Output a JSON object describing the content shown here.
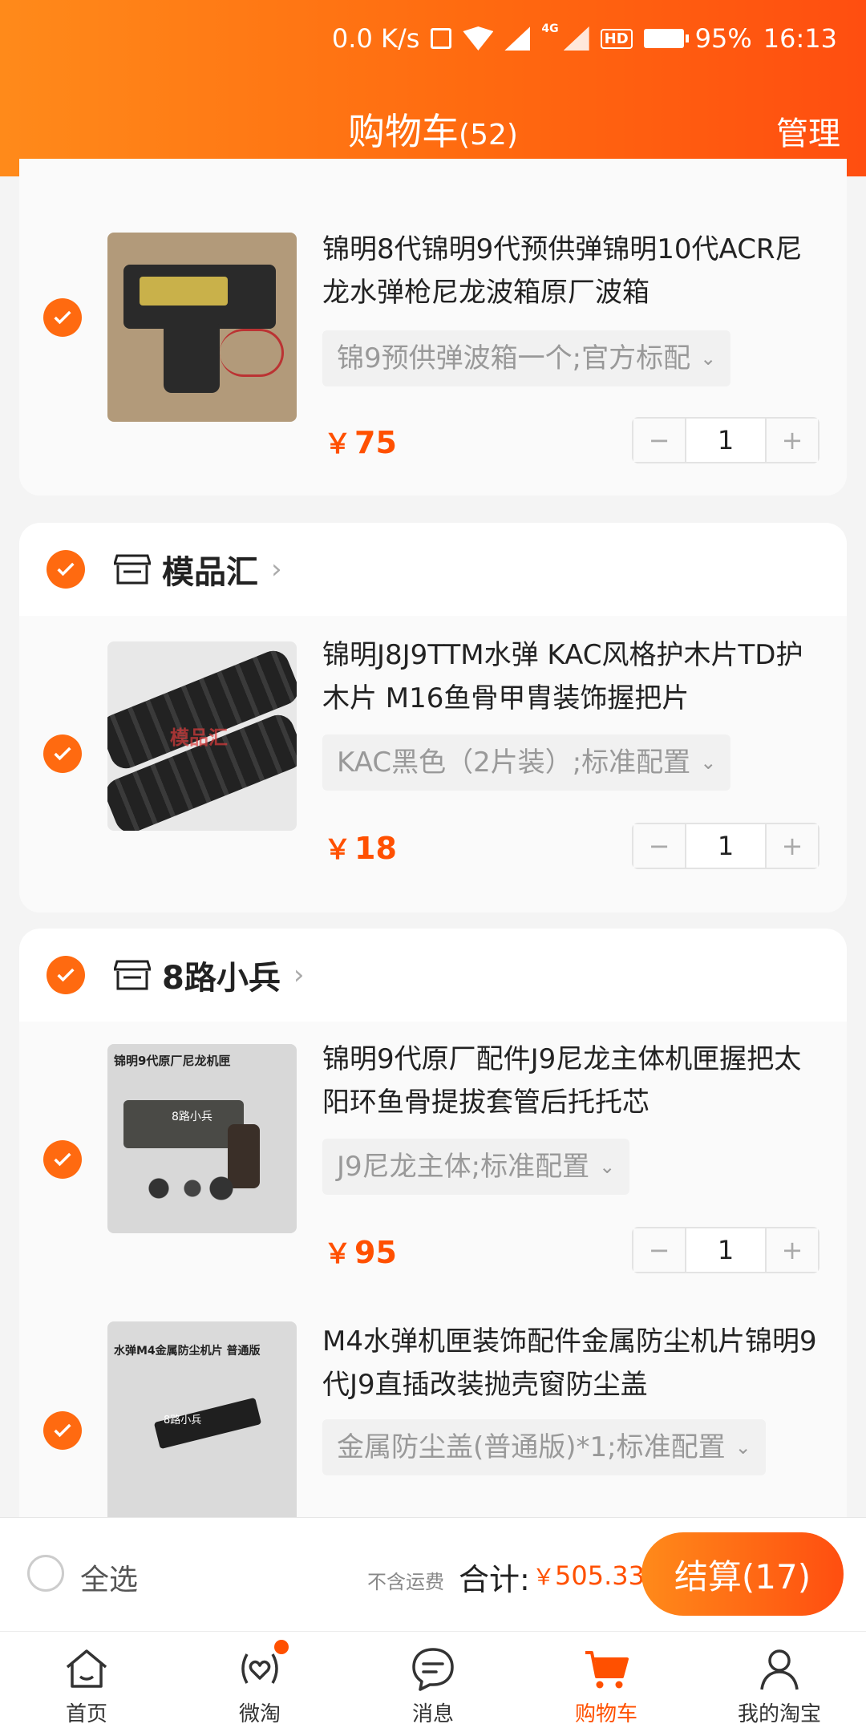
{
  "status_bar": {
    "speed": "0.0 K/s",
    "network_tag": "4G",
    "hd_label": "HD",
    "battery": "95%",
    "time": "16:13"
  },
  "header": {
    "title": "购物车",
    "count": "(52)",
    "manage": "管理"
  },
  "currency": "￥",
  "items": [
    {
      "name": "锦明8代锦明9代预供弹锦明10代ACR尼龙水弹枪尼龙波箱原厂波箱",
      "sku": "锦9预供弹波箱一个;官方标配",
      "price": "75",
      "qty": "1"
    },
    {
      "shop": "模品汇",
      "name": "锦明J8J9TTM水弹 KAC风格护木片TD护木片 M16鱼骨甲胄装饰握把片",
      "sku": "KAC黑色（2片装）;标准配置",
      "price": "18",
      "qty": "1",
      "watermark": "模品汇"
    },
    {
      "shop": "8路小兵",
      "name": "锦明9代原厂配件J9尼龙主体机匣握把太阳环鱼骨提拔套管后托托芯",
      "sku": "J9尼龙主体;标准配置",
      "price": "95",
      "qty": "1",
      "caption": "锦明9代原厂尼龙机匣",
      "watermark": "8路小兵"
    },
    {
      "name": "M4水弹机匣装饰配件金属防尘机片锦明9代J9直插改装抛壳窗防尘盖",
      "sku": "金属防尘盖(普通版)*1;标准配置",
      "caption": "水弹M4金属防尘机片 普通版",
      "watermark": "8路小兵"
    }
  ],
  "stepper": {
    "minus": "−",
    "plus": "+"
  },
  "checkout": {
    "select_all": "全选",
    "no_shipping": "不含运费",
    "total_label": "合计:",
    "total_value": "505.33",
    "pay_button": "结算(17)"
  },
  "tabs": [
    {
      "label": "首页",
      "icon": "home-icon"
    },
    {
      "label": "微淘",
      "icon": "weitao-icon"
    },
    {
      "label": "消息",
      "icon": "message-icon"
    },
    {
      "label": "购物车",
      "icon": "cart-icon"
    },
    {
      "label": "我的淘宝",
      "icon": "profile-icon"
    }
  ],
  "colors": {
    "accent": "#ff5000",
    "header_start": "#ff8a1a",
    "header_end": "#ff4e10"
  }
}
